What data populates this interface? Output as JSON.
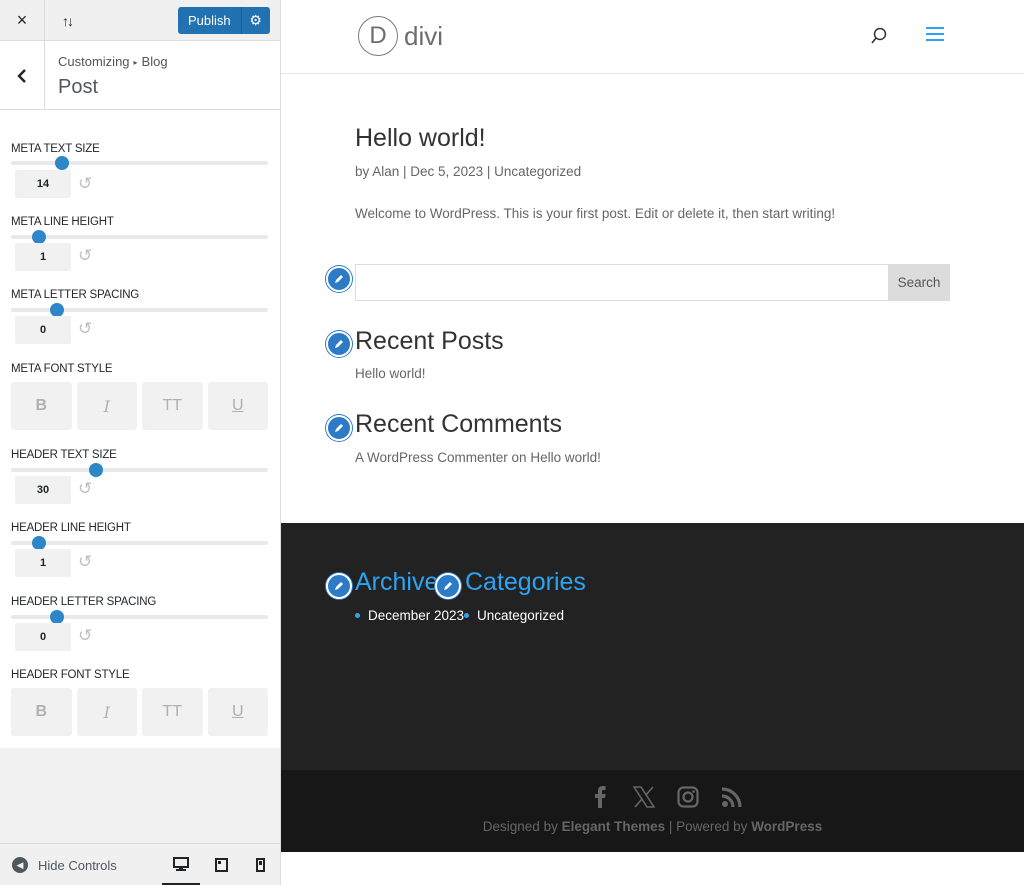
{
  "customizer": {
    "topbar": {
      "close_icon": "×",
      "publish_label": "Publish"
    },
    "breadcrumb": {
      "root": "Customizing",
      "separator": "▸",
      "parent": "Blog"
    },
    "section_title": "Post",
    "controls": [
      {
        "label": "META TEXT SIZE",
        "value": "14",
        "fraction": 0.2
      },
      {
        "label": "META LINE HEIGHT",
        "value": "1",
        "fraction": 0.11
      },
      {
        "label": "META LETTER SPACING",
        "value": "0",
        "fraction": 0.18
      }
    ],
    "meta_font_style_label": "META FONT STYLE",
    "header_controls": [
      {
        "label": "HEADER TEXT SIZE",
        "value": "30",
        "fraction": 0.33
      },
      {
        "label": "HEADER LINE HEIGHT",
        "value": "1",
        "fraction": 0.11
      },
      {
        "label": "HEADER LETTER SPACING",
        "value": "0",
        "fraction": 0.18
      }
    ],
    "header_font_style_label": "HEADER FONT STYLE",
    "font_style_buttons": [
      "B",
      "I",
      "TT",
      "U"
    ],
    "footer": {
      "hide_controls_label": "Hide Controls",
      "devices": [
        "desktop",
        "tablet",
        "mobile"
      ],
      "active_device": "desktop"
    }
  },
  "site": {
    "logo_letter": "D",
    "logo_word": "divi",
    "post": {
      "title": "Hello world!",
      "meta": "by Alan | Dec 5, 2023 | Uncategorized",
      "body": "Welcome to WordPress. This is your first post. Edit or delete it, then start writing!"
    },
    "search_button": "Search",
    "recent_posts": {
      "title": "Recent Posts",
      "items": [
        "Hello world!"
      ]
    },
    "recent_comments": {
      "title": "Recent Comments",
      "items": [
        "A WordPress Commenter on Hello world!"
      ]
    },
    "footer_widgets": [
      {
        "title": "Archives",
        "items": [
          "December 2023"
        ]
      },
      {
        "title": "Categories",
        "items": [
          "Uncategorized"
        ]
      }
    ],
    "footer_credits": {
      "prefix": "Designed by ",
      "theme_author": "Elegant Themes",
      "middle": " | Powered by ",
      "platform": "WordPress"
    },
    "social_icons": [
      "facebook-icon",
      "x-icon",
      "instagram-icon",
      "rss-icon"
    ]
  },
  "colors": {
    "accent": "#2ea3f2",
    "publish": "#2271b1",
    "slider": "#2c86c8",
    "footer_bg": "#222222"
  }
}
